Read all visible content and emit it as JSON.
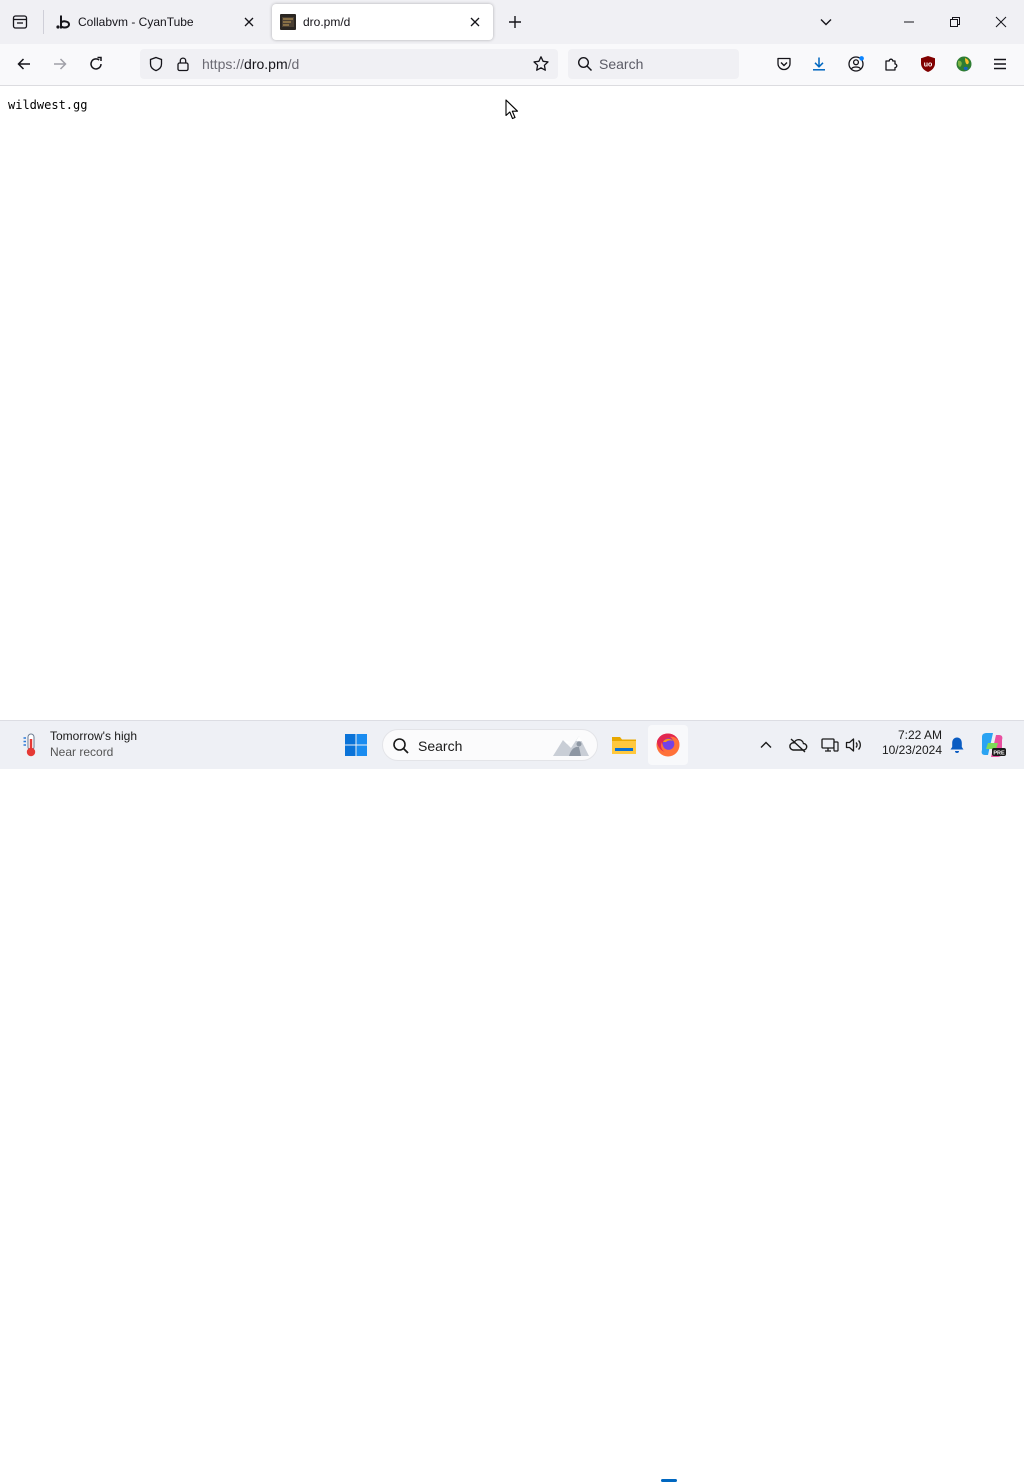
{
  "browser": {
    "tabs": [
      {
        "title": "Collabvm - CyanTube",
        "favicon": "cyantube-b-logo",
        "active": false
      },
      {
        "title": "dro.pm/d",
        "favicon": "dark-site-favicon",
        "active": true
      }
    ],
    "url": {
      "prefix": "https://",
      "host": "dro.pm",
      "path": "/d"
    },
    "search_placeholder": "Search"
  },
  "page": {
    "text": "wildwest.gg"
  },
  "taskbar": {
    "weather": {
      "title": "Tomorrow's high",
      "subtitle": "Near record"
    },
    "search_placeholder": "Search",
    "clock": {
      "time": "7:22 AM",
      "date": "10/23/2024"
    }
  },
  "colors": {
    "accent": "#0067c0",
    "tab_active_bg": "#ffffff",
    "toolbar_bg": "#f9f9fb",
    "tabstrip_bg": "#f0f0f4"
  }
}
